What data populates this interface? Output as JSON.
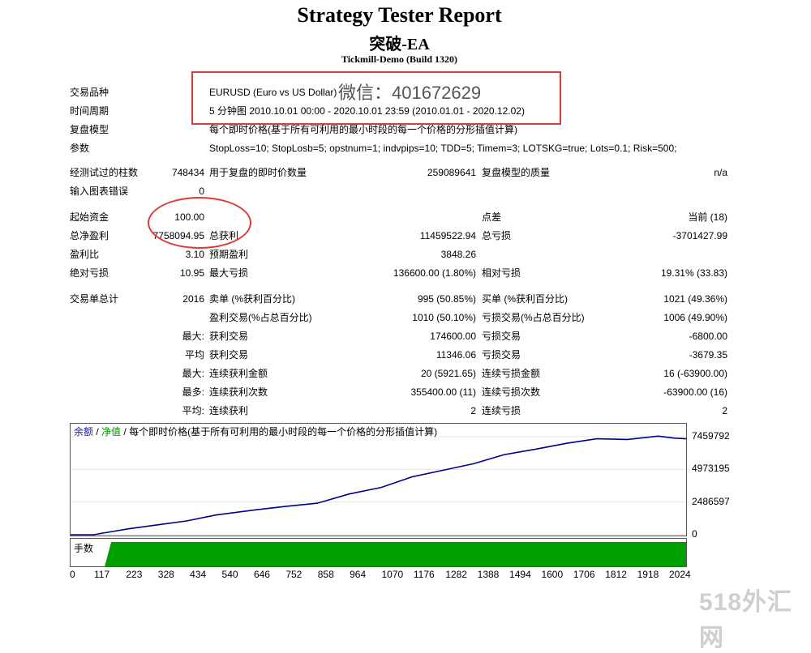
{
  "header": {
    "title": "Strategy Tester Report",
    "subtitle": "突破-EA",
    "server": "Tickmill-Demo (Build 1320)"
  },
  "settings": [
    {
      "label": "交易品种",
      "value": "EURUSD (Euro vs US Dollar)"
    },
    {
      "label": "时间周期",
      "value": "5 分钟图 2010.10.01 00:00 - 2020.10.01 23:59 (2010.01.01 - 2020.12.02)"
    },
    {
      "label": "复盘模型",
      "value": "每个即时价格(基于所有可利用的最小时段的每一个价格的分形插值计算)"
    },
    {
      "label": "参数",
      "value": "StopLoss=10; StopLosb=5; opstnum=1; indvpips=10; TDD=5; Timem=3; LOTSKG=true; Lots=0.1; Risk=500;"
    }
  ],
  "annotation": {
    "wechat": "微信：401672629"
  },
  "stats": {
    "bars_label": "经测试过的柱数",
    "bars_value": "748434",
    "ticks_label": "用于复盘的即时价数量",
    "ticks_value": "259089641",
    "quality_label": "复盘模型的质量",
    "quality_value": "n/a",
    "errors_label": "输入图表错误",
    "errors_value": "0",
    "deposit_label": "起始资金",
    "deposit_value": "100.00",
    "spread_label": "点差",
    "spread_value": "当前 (18)",
    "netprofit_label": "总净盈利",
    "netprofit_value": "7758094.95",
    "grossprofit_label": "总获利",
    "grossprofit_value": "11459522.94",
    "grossloss_label": "总亏损",
    "grossloss_value": "-3701427.99",
    "pf_label": "盈利比",
    "pf_value": "3.10",
    "expected_label": "预期盈利",
    "expected_value": "3848.26",
    "absdd_label": "绝对亏损",
    "absdd_value": "10.95",
    "maxdd_label": "最大亏损",
    "maxdd_value": "136600.00 (1.80%)",
    "reldd_label": "相对亏损",
    "reldd_value": "19.31% (33.83)",
    "trades_label": "交易单总计",
    "trades_value": "2016",
    "short_label": "卖单 (%获利百分比)",
    "short_value": "995 (50.85%)",
    "long_label": "买单 (%获利百分比)",
    "long_value": "1021 (49.36%)",
    "profittrades_label": "盈利交易(%占总百分比)",
    "profittrades_value": "1010 (50.10%)",
    "losstrades_label": "亏损交易(%占总百分比)",
    "losstrades_value": "1006 (49.90%)",
    "max1_label": "最大:",
    "largest_profit_label": "获利交易",
    "largest_profit_value": "174600.00",
    "largest_loss_label": "亏损交易",
    "largest_loss_value": "-6800.00",
    "avg_label": "平均",
    "avg_profit_label": "获利交易",
    "avg_profit_value": "11346.06",
    "avg_loss_label": "亏损交易",
    "avg_loss_value": "-3679.35",
    "max2_label": "最大:",
    "maxconswins_label": "连续获利金额",
    "maxconswins_value": "20 (5921.65)",
    "maxconsloss_label": "连续亏损金额",
    "maxconsloss_value": "16 (-63900.00)",
    "max3_label": "最多:",
    "maxconsprofit_label": "连续获利次数",
    "maxconsprofit_value": "355400.00 (11)",
    "maxconslosscount_label": "连续亏损次数",
    "maxconslosscount_value": "-63900.00 (16)",
    "avg2_label": "平均:",
    "avgconswins_label": "连续获利",
    "avgconswins_value": "2",
    "avgconsloss_label": "连续亏损",
    "avgconsloss_value": "2"
  },
  "chart_legend": {
    "balance": "余额",
    "sep": "/",
    "equity": "净值",
    "desc": "/ 每个即时价格(基于所有可利用的最小时段的每一个价格的分形插值计算)"
  },
  "volume_label": "手数",
  "watermark": "518外汇网",
  "colors": {
    "balance_line": "#00008b",
    "volume_fill": "#00a000",
    "annotation": "#e03a3a"
  },
  "chart_data": {
    "type": "line",
    "title": "",
    "xlabel": "",
    "ylabel": "",
    "x_ticks": [
      "0",
      "117",
      "223",
      "328",
      "434",
      "540",
      "646",
      "752",
      "858",
      "964",
      "1070",
      "1176",
      "1282",
      "1388",
      "1494",
      "1600",
      "1706",
      "1812",
      "1918",
      "2024"
    ],
    "y_ticks": [
      "0",
      "2486597",
      "4973195",
      "7459792"
    ],
    "ylim": [
      0,
      7459792
    ],
    "xlim": [
      0,
      2120
    ],
    "series": [
      {
        "name": "余额",
        "points": [
          [
            0,
            0
          ],
          [
            80,
            0
          ],
          [
            110,
            120000
          ],
          [
            200,
            450000
          ],
          [
            300,
            750000
          ],
          [
            400,
            1050000
          ],
          [
            500,
            1500000
          ],
          [
            640,
            1900000
          ],
          [
            740,
            2150000
          ],
          [
            850,
            2400000
          ],
          [
            960,
            3100000
          ],
          [
            1070,
            3600000
          ],
          [
            1176,
            4400000
          ],
          [
            1282,
            4900000
          ],
          [
            1388,
            5400000
          ],
          [
            1494,
            6100000
          ],
          [
            1600,
            6500000
          ],
          [
            1706,
            6950000
          ],
          [
            1812,
            7300000
          ],
          [
            1918,
            7250000
          ],
          [
            2024,
            7500000
          ],
          [
            2080,
            7350000
          ],
          [
            2120,
            7300000
          ]
        ]
      }
    ],
    "volume": {
      "start": 140,
      "end": 2120
    }
  }
}
